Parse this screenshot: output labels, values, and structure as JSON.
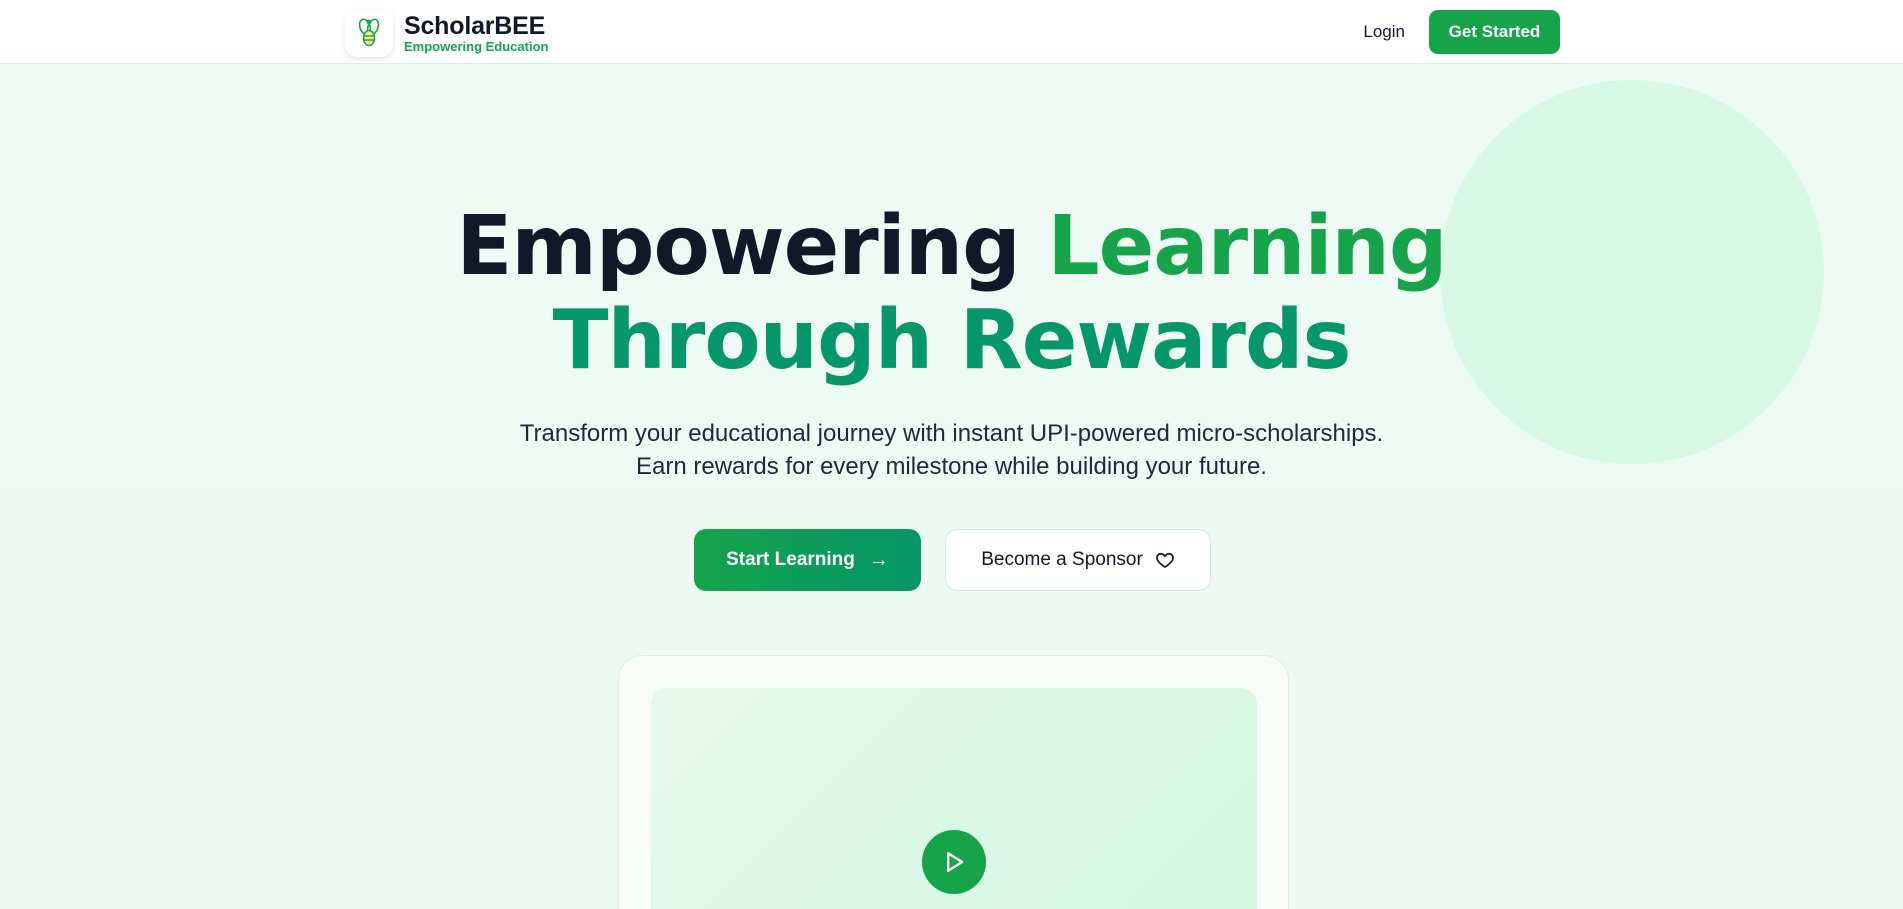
{
  "brand": {
    "name": "ScholarBEE",
    "tagline": "Empowering Education",
    "logo_icon": "bee-logo-icon"
  },
  "nav": {
    "login": "Login",
    "get_started": "Get Started"
  },
  "hero": {
    "title_part1": "Empowering",
    "title_part2": "Learning",
    "title_line2": "Through Rewards",
    "subtitle_line1": "Transform your educational journey with instant UPI-powered micro-scholarships.",
    "subtitle_line2": "Earn rewards for every milestone while building your future.",
    "primary_cta": "Start Learning",
    "primary_cta_icon": "arrow-right-icon",
    "secondary_cta": "Become a Sponsor",
    "secondary_cta_icon": "heart-icon",
    "video_icon": "play-icon"
  },
  "colors": {
    "primary": "#16a34a",
    "primary_dark": "#059669",
    "text_dark": "#111827",
    "background": "#eefbf4",
    "decor_circle": "#d8f8e6"
  }
}
